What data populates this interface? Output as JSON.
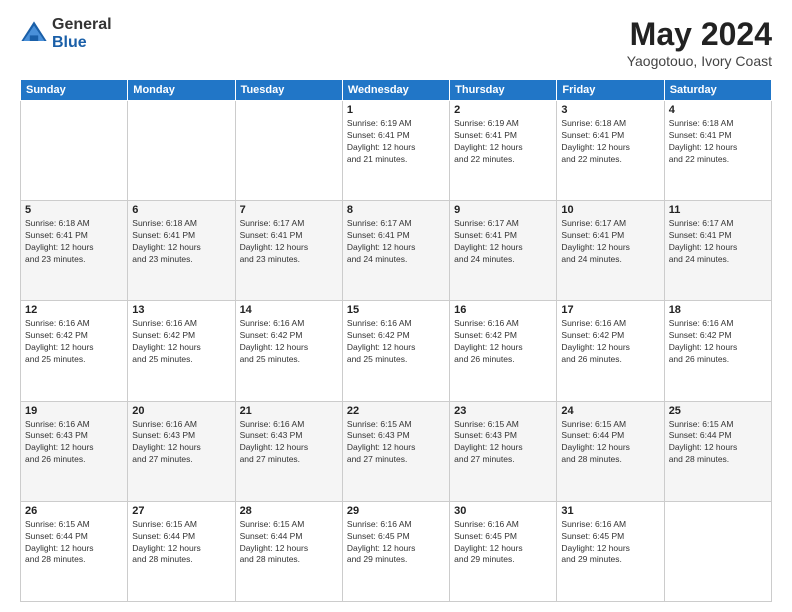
{
  "logo": {
    "general": "General",
    "blue": "Blue"
  },
  "header": {
    "month": "May 2024",
    "location": "Yaogotouo, Ivory Coast"
  },
  "weekdays": [
    "Sunday",
    "Monday",
    "Tuesday",
    "Wednesday",
    "Thursday",
    "Friday",
    "Saturday"
  ],
  "weeks": [
    [
      {
        "day": "",
        "info": ""
      },
      {
        "day": "",
        "info": ""
      },
      {
        "day": "",
        "info": ""
      },
      {
        "day": "1",
        "info": "Sunrise: 6:19 AM\nSunset: 6:41 PM\nDaylight: 12 hours\nand 21 minutes."
      },
      {
        "day": "2",
        "info": "Sunrise: 6:19 AM\nSunset: 6:41 PM\nDaylight: 12 hours\nand 22 minutes."
      },
      {
        "day": "3",
        "info": "Sunrise: 6:18 AM\nSunset: 6:41 PM\nDaylight: 12 hours\nand 22 minutes."
      },
      {
        "day": "4",
        "info": "Sunrise: 6:18 AM\nSunset: 6:41 PM\nDaylight: 12 hours\nand 22 minutes."
      }
    ],
    [
      {
        "day": "5",
        "info": "Sunrise: 6:18 AM\nSunset: 6:41 PM\nDaylight: 12 hours\nand 23 minutes."
      },
      {
        "day": "6",
        "info": "Sunrise: 6:18 AM\nSunset: 6:41 PM\nDaylight: 12 hours\nand 23 minutes."
      },
      {
        "day": "7",
        "info": "Sunrise: 6:17 AM\nSunset: 6:41 PM\nDaylight: 12 hours\nand 23 minutes."
      },
      {
        "day": "8",
        "info": "Sunrise: 6:17 AM\nSunset: 6:41 PM\nDaylight: 12 hours\nand 24 minutes."
      },
      {
        "day": "9",
        "info": "Sunrise: 6:17 AM\nSunset: 6:41 PM\nDaylight: 12 hours\nand 24 minutes."
      },
      {
        "day": "10",
        "info": "Sunrise: 6:17 AM\nSunset: 6:41 PM\nDaylight: 12 hours\nand 24 minutes."
      },
      {
        "day": "11",
        "info": "Sunrise: 6:17 AM\nSunset: 6:41 PM\nDaylight: 12 hours\nand 24 minutes."
      }
    ],
    [
      {
        "day": "12",
        "info": "Sunrise: 6:16 AM\nSunset: 6:42 PM\nDaylight: 12 hours\nand 25 minutes."
      },
      {
        "day": "13",
        "info": "Sunrise: 6:16 AM\nSunset: 6:42 PM\nDaylight: 12 hours\nand 25 minutes."
      },
      {
        "day": "14",
        "info": "Sunrise: 6:16 AM\nSunset: 6:42 PM\nDaylight: 12 hours\nand 25 minutes."
      },
      {
        "day": "15",
        "info": "Sunrise: 6:16 AM\nSunset: 6:42 PM\nDaylight: 12 hours\nand 25 minutes."
      },
      {
        "day": "16",
        "info": "Sunrise: 6:16 AM\nSunset: 6:42 PM\nDaylight: 12 hours\nand 26 minutes."
      },
      {
        "day": "17",
        "info": "Sunrise: 6:16 AM\nSunset: 6:42 PM\nDaylight: 12 hours\nand 26 minutes."
      },
      {
        "day": "18",
        "info": "Sunrise: 6:16 AM\nSunset: 6:42 PM\nDaylight: 12 hours\nand 26 minutes."
      }
    ],
    [
      {
        "day": "19",
        "info": "Sunrise: 6:16 AM\nSunset: 6:43 PM\nDaylight: 12 hours\nand 26 minutes."
      },
      {
        "day": "20",
        "info": "Sunrise: 6:16 AM\nSunset: 6:43 PM\nDaylight: 12 hours\nand 27 minutes."
      },
      {
        "day": "21",
        "info": "Sunrise: 6:16 AM\nSunset: 6:43 PM\nDaylight: 12 hours\nand 27 minutes."
      },
      {
        "day": "22",
        "info": "Sunrise: 6:15 AM\nSunset: 6:43 PM\nDaylight: 12 hours\nand 27 minutes."
      },
      {
        "day": "23",
        "info": "Sunrise: 6:15 AM\nSunset: 6:43 PM\nDaylight: 12 hours\nand 27 minutes."
      },
      {
        "day": "24",
        "info": "Sunrise: 6:15 AM\nSunset: 6:44 PM\nDaylight: 12 hours\nand 28 minutes."
      },
      {
        "day": "25",
        "info": "Sunrise: 6:15 AM\nSunset: 6:44 PM\nDaylight: 12 hours\nand 28 minutes."
      }
    ],
    [
      {
        "day": "26",
        "info": "Sunrise: 6:15 AM\nSunset: 6:44 PM\nDaylight: 12 hours\nand 28 minutes."
      },
      {
        "day": "27",
        "info": "Sunrise: 6:15 AM\nSunset: 6:44 PM\nDaylight: 12 hours\nand 28 minutes."
      },
      {
        "day": "28",
        "info": "Sunrise: 6:15 AM\nSunset: 6:44 PM\nDaylight: 12 hours\nand 28 minutes."
      },
      {
        "day": "29",
        "info": "Sunrise: 6:16 AM\nSunset: 6:45 PM\nDaylight: 12 hours\nand 29 minutes."
      },
      {
        "day": "30",
        "info": "Sunrise: 6:16 AM\nSunset: 6:45 PM\nDaylight: 12 hours\nand 29 minutes."
      },
      {
        "day": "31",
        "info": "Sunrise: 6:16 AM\nSunset: 6:45 PM\nDaylight: 12 hours\nand 29 minutes."
      },
      {
        "day": "",
        "info": ""
      }
    ]
  ]
}
